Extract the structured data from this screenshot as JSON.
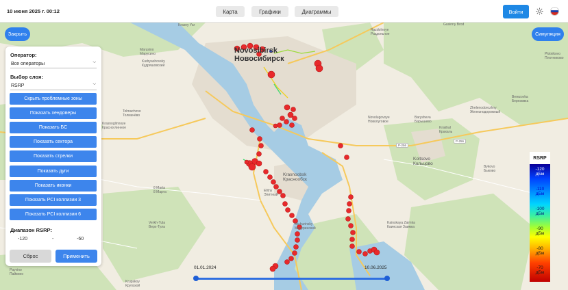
{
  "header": {
    "datetime": "10 июня 2025 г. 00:12",
    "tabs": [
      {
        "label": "Карта"
      },
      {
        "label": "Графики"
      },
      {
        "label": "Диаграммы"
      }
    ],
    "login_label": "Войти",
    "settings_icon": "gear-icon",
    "language_icon": "russia-flag-icon"
  },
  "map_controls": {
    "close_label": "Закрыть",
    "simulation_label": "Симуляция"
  },
  "panel": {
    "operator_label": "Оператор:",
    "operator_value": "Все операторы",
    "layer_label": "Выбор слоя:",
    "layer_value": "RSRP",
    "buttons": [
      {
        "label": "Скрыть проблемные зоны"
      },
      {
        "label": "Показать хендоверы"
      },
      {
        "label": "Показать БС"
      },
      {
        "label": "Показать сектора"
      },
      {
        "label": "Показать стрелки"
      },
      {
        "label": "Показать дуги"
      },
      {
        "label": "Показать иконки"
      },
      {
        "label": "Показать PCI коллизии 3"
      },
      {
        "label": "Показать PCI коллизии 6"
      }
    ],
    "range_label": "Диапазон RSRP:",
    "range_min": "-120",
    "range_sep": "-",
    "range_max": "-60",
    "reset_label": "Сброс",
    "apply_label": "Применить"
  },
  "timeline": {
    "start_date": "01.01.2024",
    "end_date": "10.06.2025"
  },
  "legend": {
    "title": "RSRP",
    "items": [
      {
        "value": "-120",
        "unit": "дБм",
        "color": "#ffffff"
      },
      {
        "value": "-110",
        "unit": "дБм",
        "color": "#0000cc"
      },
      {
        "value": "-100",
        "unit": "дБм",
        "color": "#00207a"
      },
      {
        "value": "-90",
        "unit": "дБм",
        "color": "#1a1a1a"
      },
      {
        "value": "-80",
        "unit": "дБм",
        "color": "#1a1a1a"
      },
      {
        "value": "-70",
        "unit": "дБм",
        "color": "#1a1a1a"
      }
    ]
  },
  "map": {
    "cities": [
      {
        "line1": "Novosibirsk",
        "line2": "Новосибирск"
      }
    ],
    "towns": [
      {
        "line1": "Krasnoobsk",
        "line2": "Краснообск"
      },
      {
        "line1": "Koltsovo",
        "line2": "Кольцово"
      }
    ],
    "places": [
      {
        "line1": "Razdolnoye",
        "line2": "Раздольное"
      },
      {
        "line1": "Marusino",
        "line2": "Марусино"
      },
      {
        "line1": "Kudryashovsky",
        "line2": "Кудряшовский"
      },
      {
        "line1": "Tolmachovo",
        "line2": "Толмачёво"
      },
      {
        "line1": "Krasnoglinnoye",
        "line2": "Красноглинное"
      },
      {
        "line1": "Novolugovoye",
        "line2": "Новолуговое"
      },
      {
        "line1": "Barysheva",
        "line2": "Барышево"
      },
      {
        "line1": "Krakhal",
        "line2": "Крахаль"
      },
      {
        "line1": "Zhelenodorozhny",
        "line2": "Железнодорожный"
      },
      {
        "line1": "Berezovka",
        "line2": "Березовка"
      },
      {
        "line1": "Plotnikovo",
        "line2": "Плотниково"
      },
      {
        "line1": "Elitny",
        "line2": "Элитный"
      },
      {
        "line1": "8 Marta",
        "line2": "8 Марта"
      },
      {
        "line1": "Verkh-Tula",
        "line2": "Верх-Тула"
      },
      {
        "line1": "Michurinsky",
        "line2": "Мичуринский"
      },
      {
        "line1": "Kainskaya Zaimka",
        "line2": "Каинская Заимка"
      },
      {
        "line1": "Bykovo",
        "line2": "Быково"
      },
      {
        "line1": "Payvino",
        "line2": "Пайвино"
      },
      {
        "line1": "Krupskoy",
        "line2": "Крупской"
      },
      {
        "line1": "Gusinny Brod",
        "line2": "Гусиный Брод"
      },
      {
        "line1": "Krasny Yar",
        "line2": "Красный Яр"
      }
    ],
    "road_badges": [
      "P-256",
      "P-256"
    ]
  }
}
